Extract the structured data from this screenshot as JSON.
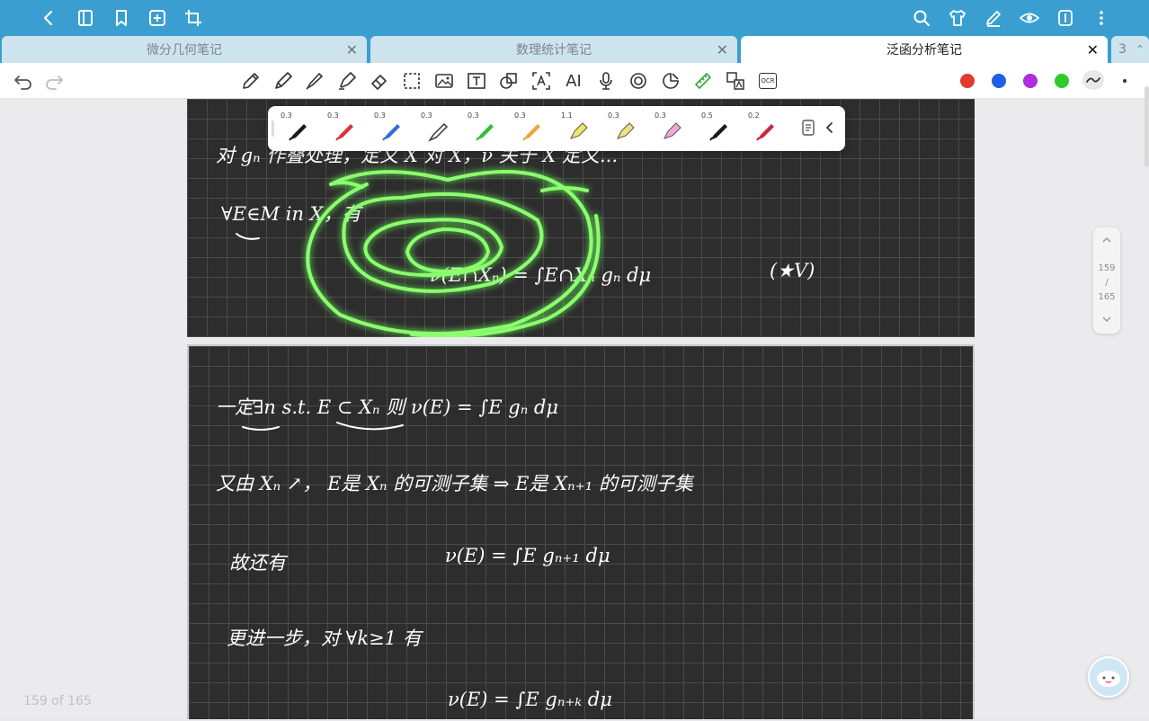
{
  "tabs": [
    {
      "label": "微分几何笔记",
      "active": false
    },
    {
      "label": "数理统计笔记",
      "active": false
    },
    {
      "label": "泛函分析笔记",
      "active": true
    }
  ],
  "tab_overflow_count": "3",
  "pens": [
    "0.3",
    "0.3",
    "0.3",
    "0.3",
    "0.3",
    "0.3",
    "1.1",
    "0.3",
    "0.3",
    "0.5",
    "0.2"
  ],
  "pen_colors": [
    "#1a1a1a",
    "#d9333c",
    "#2f6fd6",
    "#3a3a3a",
    "#2fbf3b",
    "#f0a43a",
    "#f3e46b",
    "#f1e37a",
    "#f0a9d6",
    "#1a1a1a",
    "#c7283a"
  ],
  "palette": [
    "#e23a2e",
    "#1e5fe6",
    "#b02de0",
    "#2ecc2a"
  ],
  "ai_label": "AI",
  "ocr_label": "OCR",
  "pager": {
    "current": "159",
    "sep": "/",
    "total": "165"
  },
  "page_indicator": "159 of 165",
  "notes": {
    "p1_l1": "对 gₙ 作叠处理，定义 X 对 X，ν 关于 X 定义...",
    "p1_l2": "∀E∈M in X，有",
    "p1_l3": "ν(E∩Xₙ) = ∫E∩Xₙ gₙ dμ",
    "p1_l3b": "(★V)",
    "p2_l1": "一定∃n  s.t.  E ⊂ Xₙ      则  ν(E) = ∫E gₙ dμ",
    "p2_l2": "又由 Xₙ ↗，  E是 Xₙ 的可测子集  ⇒  E是 Xₙ₊₁ 的可测子集",
    "p2_l3a": "故还有",
    "p2_l3b": "ν(E) = ∫E gₙ₊₁ dμ",
    "p2_l4": "更进一步，对 ∀k≥1   有",
    "p2_l5": "ν(E) = ∫E gₙ₊ₖ dμ"
  }
}
